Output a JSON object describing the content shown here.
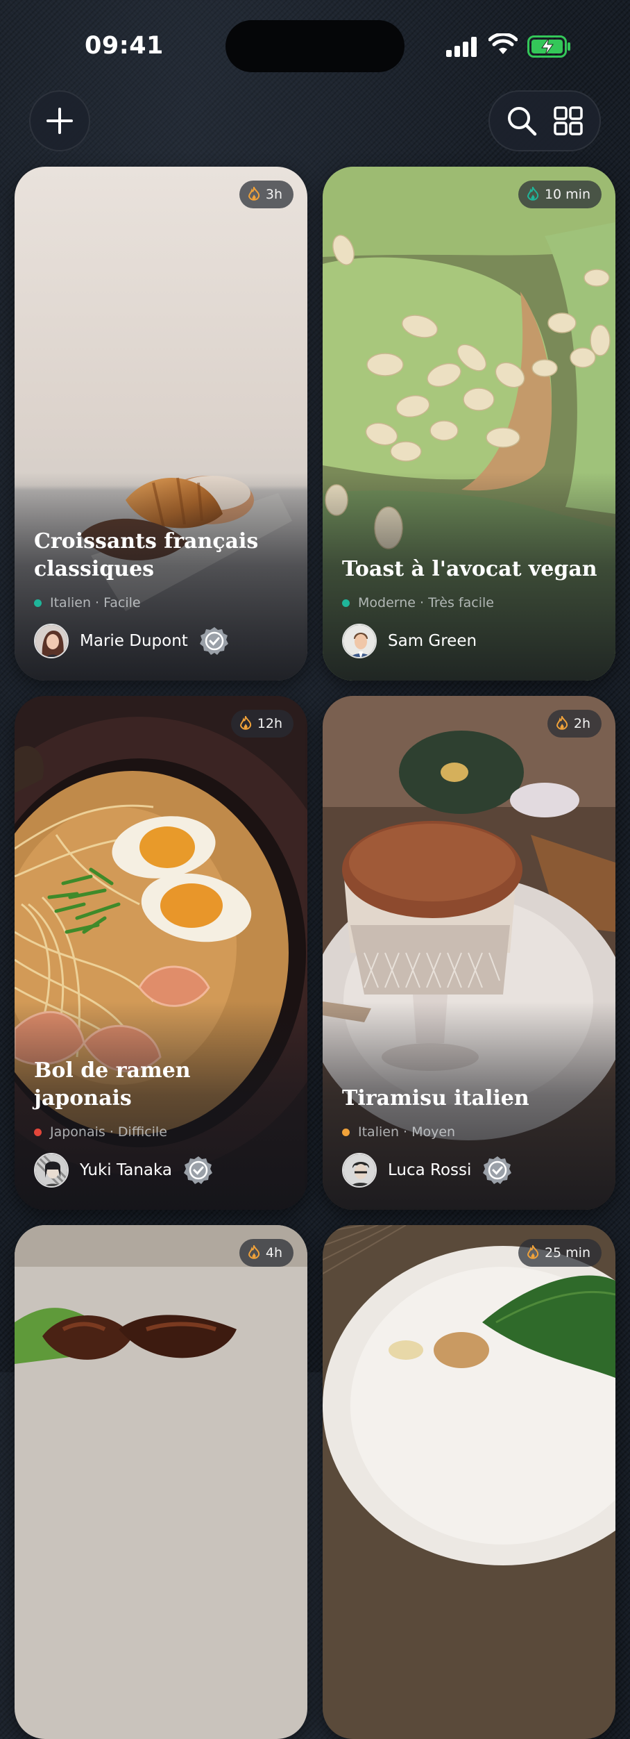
{
  "status_bar": {
    "time": "09:41"
  },
  "header": {
    "add_icon": "plus-icon",
    "search_icon": "search-icon",
    "grid_icon": "grid-icon"
  },
  "recipes": [
    {
      "title": "Croissants français classiques",
      "duration": "3h",
      "cuisine": "Italien",
      "difficulty": "Facile",
      "meta": "Italien · Facile",
      "dot_color": "#1fb59a",
      "author": "Marie Dupont",
      "verified": true
    },
    {
      "title": "Toast à l'avocat vegan",
      "duration": "10 min",
      "cuisine": "Moderne",
      "difficulty": "Très facile",
      "meta": "Moderne · Très facile",
      "dot_color": "#1fb59a",
      "author": "Sam Green",
      "verified": false
    },
    {
      "title": "Bol de ramen japonais",
      "duration": "12h",
      "cuisine": "Japonais",
      "difficulty": "Difficile",
      "meta": "Japonais · Difficile",
      "dot_color": "#e2463a",
      "author": "Yuki Tanaka",
      "verified": true
    },
    {
      "title": "Tiramisu italien",
      "duration": "2h",
      "cuisine": "Italien",
      "difficulty": "Moyen",
      "meta": "Italien · Moyen",
      "dot_color": "#f0a23a",
      "author": "Luca Rossi",
      "verified": true
    },
    {
      "duration": "4h"
    },
    {
      "duration": "25 min"
    }
  ],
  "colors": {
    "background": "#171d26",
    "flame_orange": "#f0a23a",
    "flame_teal": "#1fb59a"
  }
}
